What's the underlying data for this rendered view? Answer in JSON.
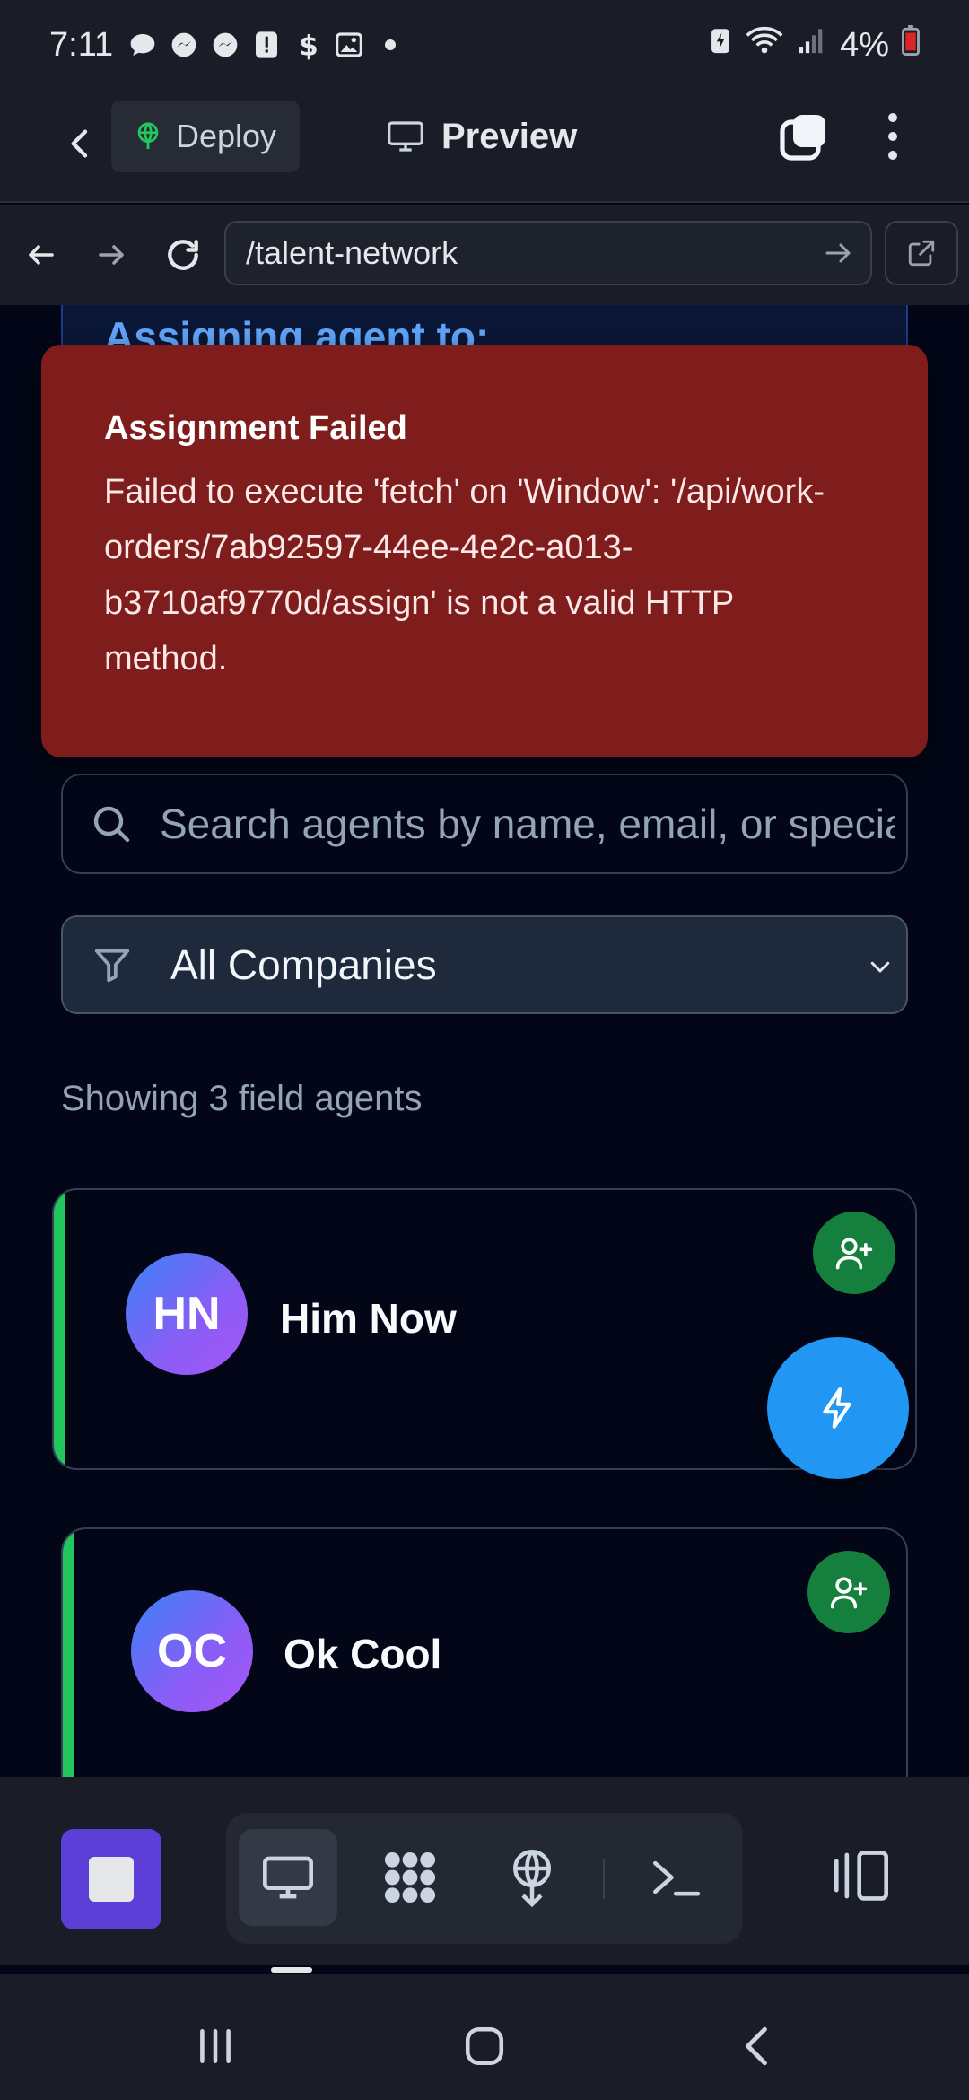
{
  "status_bar": {
    "time": "7:11",
    "battery": "4%",
    "icons": [
      "chat-bubble-icon",
      "messenger-icon",
      "messenger-icon",
      "alert-icon",
      "dollar-icon",
      "image-icon",
      "dot-icon"
    ]
  },
  "header": {
    "deploy_label": "Deploy",
    "preview_label": "Preview"
  },
  "browser": {
    "url": "/talent-network"
  },
  "banner": {
    "text": "Assigning agent to:"
  },
  "toast": {
    "title": "Assignment Failed",
    "message": "Failed to execute 'fetch' on 'Window': '/api/work-orders/7ab92597-44ee-4e2c-a013-b3710af9770d/assign' is not a valid HTTP method."
  },
  "search": {
    "placeholder": "Search agents by name, email, or specialty"
  },
  "filter": {
    "selected": "All Companies"
  },
  "list": {
    "count_text": "Showing 3 field agents",
    "agents": [
      {
        "initials": "HN",
        "name": "Him Now"
      },
      {
        "initials": "OC",
        "name": "Ok Cool"
      }
    ]
  },
  "colors": {
    "accent_green": "#22c55e",
    "toast_red": "#7f1d1d",
    "fab_blue": "#2196f3",
    "stop_purple": "#5b3fd6"
  }
}
